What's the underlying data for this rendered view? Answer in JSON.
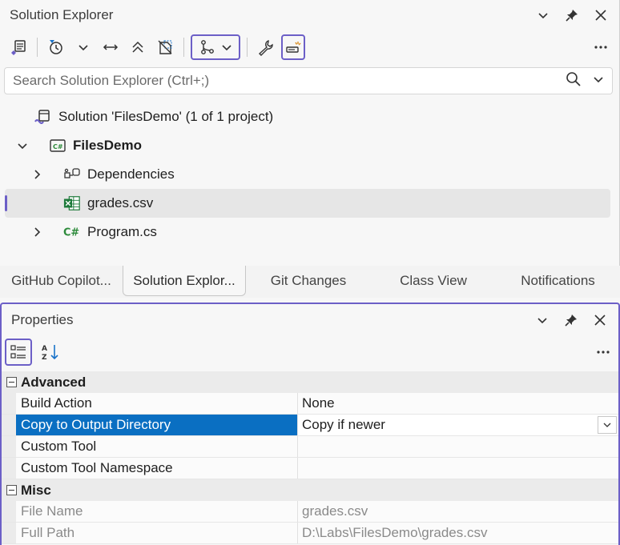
{
  "solution_explorer": {
    "title": "Solution Explorer",
    "search_placeholder": "Search Solution Explorer (Ctrl+;)",
    "tree": {
      "solution_label": "Solution 'FilesDemo' (1 of 1 project)",
      "project_label": "FilesDemo",
      "items": [
        {
          "label": "Dependencies",
          "icon": "dependencies-icon"
        },
        {
          "label": "grades.csv",
          "icon": "excel-file-icon"
        },
        {
          "label": "Program.cs",
          "icon": "csharp-file-icon"
        }
      ]
    }
  },
  "tabs": [
    {
      "label": "GitHub Copilot..."
    },
    {
      "label": "Solution Explor..."
    },
    {
      "label": "Git Changes"
    },
    {
      "label": "Class View"
    },
    {
      "label": "Notifications"
    }
  ],
  "properties": {
    "title": "Properties",
    "categories": {
      "advanced": "Advanced",
      "misc": "Misc"
    },
    "rows": [
      {
        "name": "Build Action",
        "value": "None"
      },
      {
        "name": "Copy to Output Directory",
        "value": "Copy if newer"
      },
      {
        "name": "Custom Tool",
        "value": ""
      },
      {
        "name": "Custom Tool Namespace",
        "value": ""
      },
      {
        "name": "File Name",
        "value": "grades.csv"
      },
      {
        "name": "Full Path",
        "value": "D:\\Labs\\FilesDemo\\grades.csv"
      }
    ]
  },
  "colors": {
    "accent": "#6c5fc7",
    "selection": "#0a6fc2",
    "excel": "#1d7a3a",
    "csharp": "#2c8a3a"
  }
}
